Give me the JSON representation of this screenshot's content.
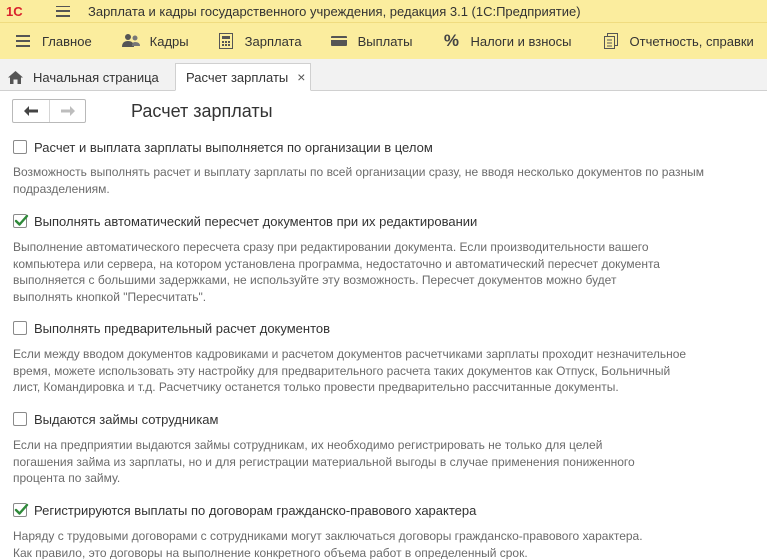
{
  "window": {
    "title": "Зарплата и кадры государственного учреждения, редакция 3.1  (1С:Предприятие)",
    "logo_text": "1С"
  },
  "sections": [
    {
      "label": "Главное",
      "icon": "burger-menu-icon"
    },
    {
      "label": "Кадры",
      "icon": "people-icon"
    },
    {
      "label": "Зарплата",
      "icon": "calculator-icon"
    },
    {
      "label": "Выплаты",
      "icon": "wallet-icon"
    },
    {
      "label": "Налоги и взносы",
      "icon": "percent-icon"
    },
    {
      "label": "Отчетность, справки",
      "icon": "reports-icon"
    }
  ],
  "tabs": {
    "home": {
      "label": "Начальная страница",
      "icon": "home-icon"
    },
    "active": {
      "label": "Расчет зарплаты",
      "close": "×"
    }
  },
  "page": {
    "title": "Расчет зарплаты"
  },
  "options": [
    {
      "label": "Расчет и выплата зарплаты выполняется по организации в целом",
      "checked": false,
      "description": [
        "Возможность выполнять расчет и выплату зарплаты по всей организации сразу, не вводя несколько документов по разным",
        "подразделениям."
      ]
    },
    {
      "label": "Выполнять автоматический пересчет документов при их редактировании",
      "checked": true,
      "description": [
        "Выполнение автоматического пересчета сразу при редактировании документа. Если производительности вашего",
        "компьютера или сервера, на котором установлена программа, недостаточно и автоматический пересчет документа",
        "выполняется с большими задержками, не используйте эту возможность. Пересчет документов можно будет",
        "выполнять кнопкой \"Пересчитать\"."
      ]
    },
    {
      "label": "Выполнять предварительный расчет документов",
      "checked": false,
      "description": [
        "Если между вводом документов кадровиками и расчетом документов расчетчиками зарплаты проходит незначительное",
        "время, можете использовать эту настройку для предварительного расчета таких документов как Отпуск, Больничный",
        "лист, Командировка и т.д. Расчетчику останется только провести предварительно рассчитанные документы."
      ]
    },
    {
      "label": "Выдаются займы сотрудникам",
      "checked": false,
      "description": [
        "Если на предприятии выдаются займы сотрудникам, их необходимо регистрировать не только для целей",
        "погашения займа из зарплаты, но и для регистрации материальной выгоды в случае применения пониженного",
        "процента по займу."
      ]
    },
    {
      "label": "Регистрируются выплаты по договорам гражданско-правового характера",
      "checked": true,
      "description": [
        "Наряду с трудовыми договорами с сотрудниками могут заключаться договоры гражданско-правового характера.",
        "Как правило, это договоры на выполнение конкретного объема работ в определенный срок."
      ]
    }
  ],
  "colors": {
    "panel": "#fbed9e",
    "check": "#2f8a3a",
    "logo": "#d9232d"
  }
}
